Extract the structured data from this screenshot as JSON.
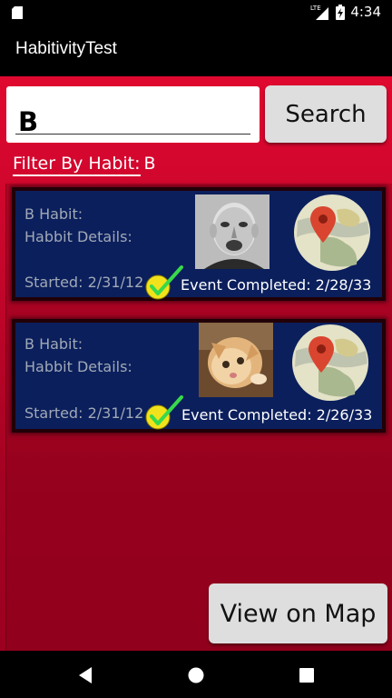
{
  "status_bar": {
    "time": "4:34",
    "network": "LTE",
    "icons": [
      "sd-card-icon",
      "signal-icon",
      "battery-charging-icon"
    ]
  },
  "app_bar": {
    "title": "HabitivityTest"
  },
  "search": {
    "value": "B",
    "button_label": "Search"
  },
  "filter": {
    "label": "Filter By Habit:",
    "value": "B"
  },
  "habits": [
    {
      "name": "B Habit:",
      "details": "Habbit Details:",
      "started": "Started: 2/31/12",
      "event": "Event Completed: 2/28/33",
      "image": "portrait-photo",
      "map_icon": "map-location-icon"
    },
    {
      "name": "B Habit:",
      "details": "Habbit Details:",
      "started": "Started: 2/31/12",
      "event": "Event Completed: 2/26/33",
      "image": "kitten-photo",
      "map_icon": "map-location-icon"
    }
  ],
  "map_button": {
    "label": "View on Map"
  },
  "nav_bar": {
    "icons": [
      "back-icon",
      "home-icon",
      "recents-icon"
    ]
  },
  "colors": {
    "background_red": "#d90a32",
    "card_navy": "#0b1f5c",
    "card_border": "#210008",
    "check_yellow": "#f2e21c",
    "check_green": "#38d94a",
    "pin_red": "#d9452f"
  }
}
